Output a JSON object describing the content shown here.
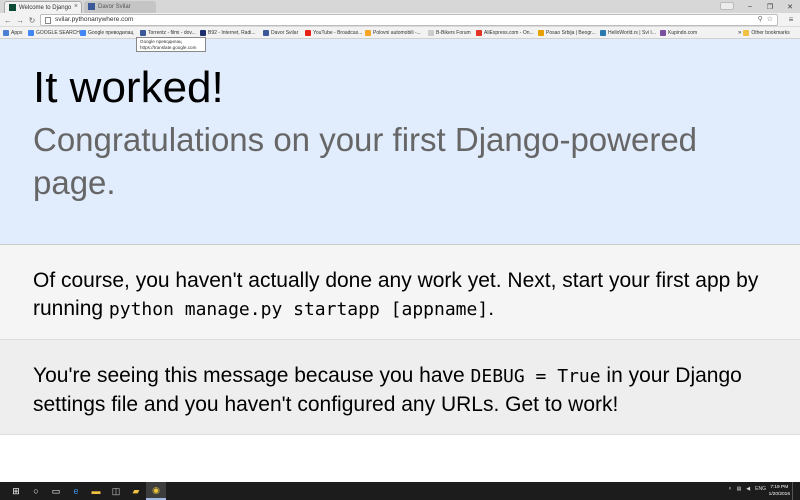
{
  "browser": {
    "tabs": [
      {
        "title": "Welcome to Django",
        "active": true
      },
      {
        "title": "Davor Svilar",
        "active": false
      }
    ],
    "url": "svilar.pythonanywhere.com",
    "bookmarks": [
      {
        "label": "Apps",
        "icon": "apps-grid-icon",
        "color": "#4a7fd4"
      },
      {
        "label": "GOOGLE SEARCH",
        "icon": "google-icon",
        "color": "#4285f4"
      },
      {
        "label": "Google преводилац",
        "icon": "google-translate-icon",
        "color": "#4285f4"
      },
      {
        "label": "Torrentz - filmi - dov...",
        "icon": "torrentz-icon",
        "color": "#3b5998"
      },
      {
        "label": "B92 - Internet, Radi...",
        "icon": "b92-icon",
        "color": "#1c2f6b"
      },
      {
        "label": "Davor Svilar",
        "icon": "facebook-icon",
        "color": "#3b5998"
      },
      {
        "label": "YouTube - Broadcas...",
        "icon": "youtube-icon",
        "color": "#e62117"
      },
      {
        "label": "Polovni automobili -...",
        "icon": "polovni-icon",
        "color": "#f5a623"
      },
      {
        "label": "B-Bikers Forum",
        "icon": "bbikers-icon",
        "color": "#cccccc"
      },
      {
        "label": "AliExpress.com - On...",
        "icon": "aliexpress-icon",
        "color": "#e43225"
      },
      {
        "label": "Posao Srbija | Beogr...",
        "icon": "posao-icon",
        "color": "#e6a100"
      },
      {
        "label": "HelloWorld.rs | Svi I...",
        "icon": "helloworld-icon",
        "color": "#2a7ab0"
      },
      {
        "label": "Kupindo.com",
        "icon": "kupindo-icon",
        "color": "#7a4fa0"
      }
    ],
    "other_bookmarks": "Other bookmarks",
    "tooltip": {
      "line1": "Google преводилац",
      "line2": "https://translate.google.com"
    }
  },
  "page": {
    "title": "It worked!",
    "subtitle": "Congratulations on your first Django-powered page.",
    "instructions": {
      "before": "Of course, you haven't actually done any work yet. Next, start your first app by running ",
      "code": "python manage.py startapp [appname]",
      "after": "."
    },
    "explanation": {
      "before": "You're seeing this message because you have ",
      "code": "DEBUG = True",
      "after": " in your Django settings file and you haven't configured any URLs. Get to work!"
    },
    "colors": {
      "hero_bg": "#e1ecfd",
      "instructions_bg": "#f5f5f5",
      "explanation_bg": "#eeeeee"
    }
  },
  "taskbar": {
    "time": "7:19 PM",
    "date": "1/20/2016",
    "language": "ENG"
  }
}
